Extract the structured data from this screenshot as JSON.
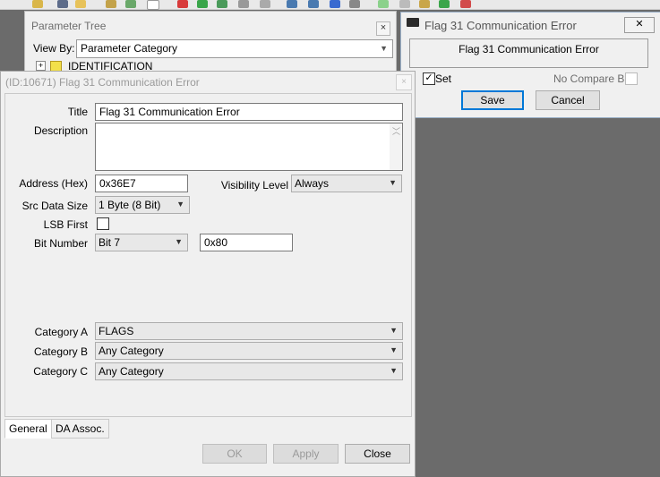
{
  "param_tree": {
    "title": "Parameter Tree",
    "close": "×",
    "view_by_label": "View By:",
    "view_by_value": "Parameter Category",
    "tree_item": "IDENTIFICATION",
    "tree_expand": "+"
  },
  "flag_dialog": {
    "title": "Flag 31 Communication Error",
    "close": "✕",
    "name": "Flag 31 Communication Error",
    "set_label": "Set",
    "set_checked": "✓",
    "no_compare_label": "No Compare Bin",
    "save_label": "Save",
    "cancel_label": "Cancel"
  },
  "main_dialog": {
    "title": "(ID:10671) Flag 31 Communication Error",
    "close": "×",
    "title_label": "Title",
    "title_value": "Flag 31 Communication Error",
    "description_label": "Description",
    "description_value": "",
    "address_label": "Address (Hex)",
    "address_value": "0x36E7",
    "visibility_label": "Visibility Level",
    "visibility_value": "Always",
    "src_size_label": "Src Data Size",
    "src_size_value": "1 Byte (8 Bit)",
    "lsb_first_label": "LSB First",
    "bit_number_label": "Bit Number",
    "bit_number_value": "Bit 7",
    "bit_mask_value": "0x80",
    "category_a_label": "Category A",
    "category_a_value": "FLAGS",
    "category_b_label": "Category B",
    "category_b_value": "Any Category",
    "category_c_label": "Category C",
    "category_c_value": "Any Category",
    "tabs": [
      "General",
      "DA Assoc."
    ],
    "ok_label": "OK",
    "apply_label": "Apply",
    "close_label": "Close"
  },
  "colors": {
    "focus_blue": "#0078d7",
    "dialog_bg": "#f0f0f0",
    "desktop_bg": "#6b6b6b"
  }
}
